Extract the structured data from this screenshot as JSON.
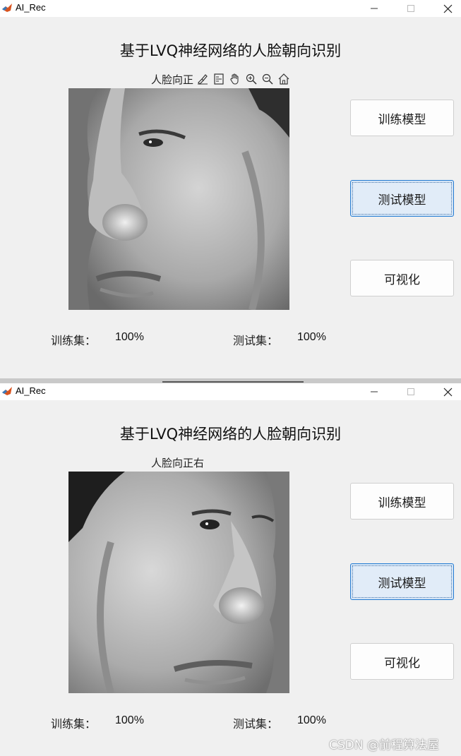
{
  "windows": [
    {
      "title": "AI_Rec",
      "heading": "基于LVQ神经网络的人脸朝向识别",
      "axis_title": "人脸向正",
      "show_toolbar": true,
      "toolbar_icons": [
        "brush-icon",
        "datatip-icon",
        "pan-hand-icon",
        "zoom-in-icon",
        "zoom-out-icon",
        "home-icon"
      ],
      "buttons": {
        "train": "训练模型",
        "test": "测试模型",
        "visualize": "可视化"
      },
      "train_label": "训练集：",
      "train_value": "100%",
      "test_label": "测试集：",
      "test_value": "100%",
      "face_orientation": "left"
    },
    {
      "title": "AI_Rec",
      "heading": "基于LVQ神经网络的人脸朝向识别",
      "axis_title": "人脸向正右",
      "show_toolbar": false,
      "buttons": {
        "train": "训练模型",
        "test": "测试模型",
        "visualize": "可视化"
      },
      "train_label": "训练集：",
      "train_value": "100%",
      "test_label": "测试集：",
      "test_value": "100%",
      "face_orientation": "right"
    }
  ],
  "watermark": "CSDN @前程算法屋"
}
